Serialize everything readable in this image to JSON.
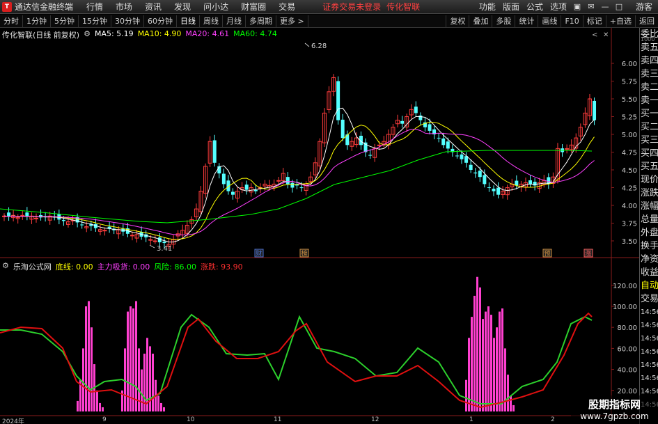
{
  "menubar": {
    "app_title": "通达信金融终端",
    "items": [
      "行情",
      "市场",
      "资讯",
      "发现",
      "问小达",
      "财富圈",
      "交易"
    ],
    "alert": "证券交易未登录",
    "alert2": "传化智联",
    "right_items": [
      "功能",
      "版面",
      "公式",
      "选项"
    ],
    "guest": "游客"
  },
  "toolbar": {
    "periods": [
      "分时",
      "1分钟",
      "5分钟",
      "15分钟",
      "30分钟",
      "60分钟",
      "日线",
      "周线",
      "月线",
      "多周期",
      "更多 >"
    ],
    "active": "日线",
    "right": [
      "复权",
      "叠加",
      "多股",
      "统计",
      "画线",
      "F10",
      "标记",
      "+自选",
      "返回"
    ]
  },
  "info": {
    "name": "传化智联(日线 前复权)",
    "ma5": "MA5: 5.19",
    "ma10": "MA10: 4.90",
    "ma20": "MA20: 4.61",
    "ma60": "MA60: 4.74",
    "colors": {
      "ma5": "#ffffff",
      "ma10": "#ffff00",
      "ma20": "#ff40ff",
      "ma60": "#00ff00"
    }
  },
  "price_axis": [
    "6.00",
    "5.75",
    "5.50",
    "5.25",
    "5.00",
    "4.75",
    "4.50",
    "4.25",
    "4.00",
    "3.75",
    "3.50"
  ],
  "price_annotations": {
    "high": "6.28",
    "low": "3.41"
  },
  "event_markers": [
    {
      "label": "财",
      "color": "#4a6fd0"
    },
    {
      "label": "榜",
      "color": "#d09040"
    },
    {
      "label": "预",
      "color": "#d09040"
    },
    {
      "label": "涨",
      "color": "#ff6060"
    }
  ],
  "oscillator": {
    "name": "乐淘公式网",
    "bottom_line": "底线: 0.00",
    "main_force": "主力吸货: 0.00",
    "risk": "风险: 86.00",
    "rise_fall": "涨跌: 93.90",
    "axis": [
      "120.00",
      "100.00",
      "80.00",
      "60.00",
      "40.00",
      "20.00"
    ]
  },
  "right_panel": {
    "tag": "1000",
    "items": [
      "委比",
      "卖五",
      "卖四",
      "卖三",
      "卖二",
      "卖一",
      "买一",
      "买二",
      "买三",
      "买四",
      "买五",
      "现价",
      "涨跌",
      "涨幅",
      "总量",
      "外盘",
      "换手",
      "净资",
      "收益",
      "自动",
      "交易",
      "14:56",
      "14:56",
      "14:56",
      "14:56",
      "14:56",
      "14:56",
      "14:56",
      "14:56"
    ]
  },
  "time_axis": [
    "2024年",
    "9",
    "10",
    "11",
    "12",
    "1",
    "2"
  ],
  "watermark": {
    "line1": "股期指标网",
    "line2": "www.7gpzb.com"
  }
}
